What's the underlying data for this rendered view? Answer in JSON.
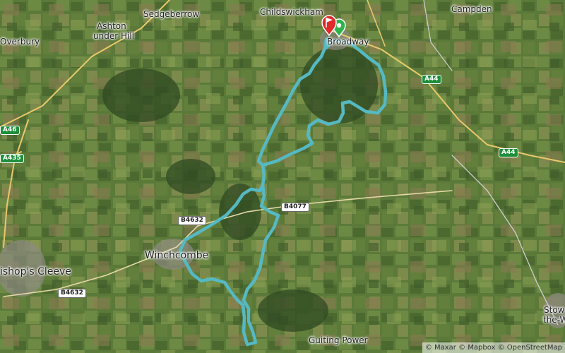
{
  "map": {
    "places": {
      "sedgeberrow": "Sedgeberrow",
      "childswickham": "Childswickham",
      "campden": "Campden",
      "ashton": "Ashton",
      "under_hill": "under Hill",
      "overbury": "Overbury",
      "broadway": "Broadway",
      "winchcombe": "Winchcombe",
      "bishops_cleeve": "ishop's Cleeve",
      "guiting_power": "Guiting Power",
      "stow_1": "Stow",
      "stow_2": "the-W"
    },
    "roads": {
      "a44_upper": "A44",
      "a44_lower": "A44",
      "a46": "A46",
      "a435": "A435",
      "b4632_upper": "B4632",
      "b4632_lower": "B4632",
      "b4077": "B4077"
    },
    "attribution": "© Maxar © Mapbox © OpenStreetMap"
  },
  "colors": {
    "route": "#55b9c3",
    "start_marker": "#2fb24a",
    "finish_marker": "#e02a2a"
  }
}
